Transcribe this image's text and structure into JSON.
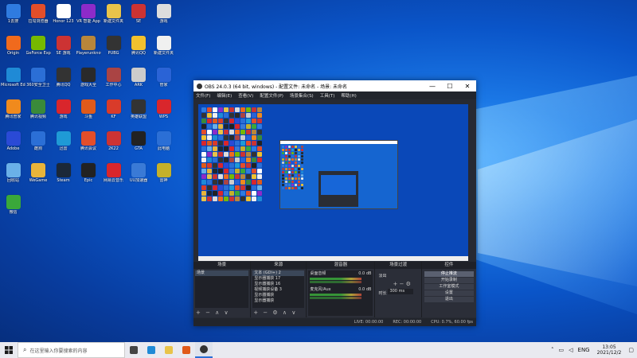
{
  "desktop": {
    "icons": [
      {
        "label": "1去搜",
        "color": "#2f7be0"
      },
      {
        "label": "拉勾浏览器",
        "color": "#e34e2a"
      },
      {
        "label": "Honor 123",
        "color": "#ffffff"
      },
      {
        "label": "VR 智能 App",
        "color": "#8d2bc9"
      },
      {
        "label": "新建文件夹",
        "color": "#e8c34a"
      },
      {
        "label": "SE",
        "color": "#c33"
      },
      {
        "label": "游戏",
        "color": "#ddd"
      },
      {
        "label": "Origin",
        "color": "#f06a1d"
      },
      {
        "label": "GeForce Experience",
        "color": "#76b900"
      },
      {
        "label": "SE 游戏",
        "color": "#c33"
      },
      {
        "label": "Playerunknown",
        "color": "#b8863b"
      },
      {
        "label": "PUBG",
        "color": "#333"
      },
      {
        "label": "腾讯QQ",
        "color": "#f2c12e"
      },
      {
        "label": "新建文件夹",
        "color": "#f0f0f0"
      },
      {
        "label": "Microsoft Edge",
        "color": "#1f8ad6"
      },
      {
        "label": "360安全卫士",
        "color": "#2b6fd6"
      },
      {
        "label": "腾讯QQ",
        "color": "#333"
      },
      {
        "label": "游戏大全",
        "color": "#2a2a2a"
      },
      {
        "label": "工作中心",
        "color": "#a44"
      },
      {
        "label": "ARK",
        "color": "#ccc"
      },
      {
        "label": "管家",
        "color": "#2a63d6"
      },
      {
        "label": "腾讯管家",
        "color": "#f08a1d"
      },
      {
        "label": "腾讯视频",
        "color": "#3a8a3a"
      },
      {
        "label": "游戏",
        "color": "#d9262c"
      },
      {
        "label": "斗鱼",
        "color": "#e05a1a"
      },
      {
        "label": "KF",
        "color": "#d93b2a"
      },
      {
        "label": "英雄联盟",
        "color": "#333"
      },
      {
        "label": "WPS",
        "color": "#d9262c"
      },
      {
        "label": "Adobe",
        "color": "#2a4ad6"
      },
      {
        "label": "酷狗",
        "color": "#2b6fd6"
      },
      {
        "label": "迅雷",
        "color": "#1f9ad6"
      },
      {
        "label": "腾讯会议",
        "color": "#e34e2a"
      },
      {
        "label": "2K22",
        "color": "#c33"
      },
      {
        "label": "GTA",
        "color": "#222"
      },
      {
        "label": "此电脑",
        "color": "#2b6fd6"
      },
      {
        "label": "回收站",
        "color": "#6ab0e8"
      },
      {
        "label": "WeGame",
        "color": "#e8b43a"
      },
      {
        "label": "Steam",
        "color": "#1b2838"
      },
      {
        "label": "Epic",
        "color": "#222"
      },
      {
        "label": "网易云音乐",
        "color": "#d9262c"
      },
      {
        "label": "UU加速器",
        "color": "#3a7ad6"
      },
      {
        "label": "雷神",
        "color": "#c4b02a"
      },
      {
        "label": "微信",
        "color": "#3aa83a"
      }
    ]
  },
  "obs": {
    "title": "OBS 24.0.3 (64 bit, windows) - 配置文件: 未命名 - 场景: 未命名",
    "menu": [
      "文件(F)",
      "编辑(E)",
      "查看(V)",
      "配置文件(P)",
      "场景集合(S)",
      "工具(T)",
      "帮助(H)"
    ],
    "docks": {
      "scenes": {
        "header": "场景",
        "items": [
          "场景"
        ]
      },
      "sources": {
        "header": "来源",
        "items": [
          "文本 (GDI+) 2",
          "显示器捕获 17",
          "显示器捕获 16",
          "视频捕获设备 3",
          "显示器捕获",
          "显示器捕获"
        ]
      },
      "mixer": {
        "header": "混音器",
        "channels": [
          {
            "name": "桌面音频",
            "vol": "0.0 dB"
          },
          {
            "name": "麦克风/Aux",
            "vol": "0.0 dB"
          }
        ]
      },
      "transitions": {
        "header": "场景过渡",
        "type": "淡出",
        "duration_label": "时长",
        "duration": "300 ms"
      },
      "controls": {
        "header": "控件",
        "buttons": [
          "停止推流",
          "开始录制",
          "工作室模式",
          "设置",
          "退出"
        ]
      }
    },
    "status": {
      "live": "LIVE: 00:00:00",
      "rec": "REC: 00:00:00",
      "cpu": "CPU: 0.7%, 60.00 fps"
    }
  },
  "taskbar": {
    "search_placeholder": "在这里输入你要搜索的内容",
    "icons": [
      {
        "name": "task-view-icon",
        "color": "#444"
      },
      {
        "name": "edge-icon",
        "color": "#1f8ad6"
      },
      {
        "name": "file-explorer-icon",
        "color": "#e8c34a"
      },
      {
        "name": "app-icon",
        "color": "#e05a1a"
      },
      {
        "name": "obs-icon",
        "color": "#333"
      }
    ],
    "tray": {
      "lang": "ENG",
      "time": "13:05",
      "date": "2021/12/2"
    }
  }
}
